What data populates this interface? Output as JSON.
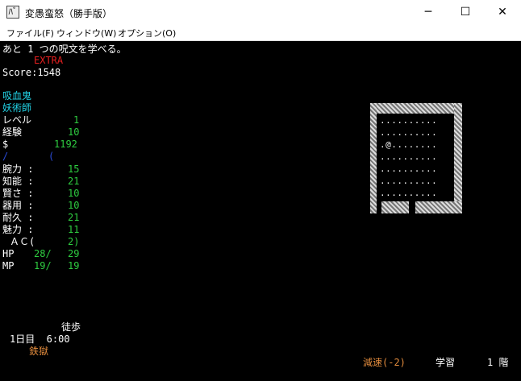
{
  "window": {
    "title": "変愚蛮怒（勝手版）",
    "icon_glyph": "ﾊﾞ",
    "minimize": "─",
    "maximize": "☐",
    "close": "✕"
  },
  "menu": [
    "ファイル(F)",
    "ウィンドウ(W)",
    "オプション(O)"
  ],
  "message": "あと 1 つの呪文を学べる。",
  "extra": "EXTRA",
  "score": "Score:1548",
  "race": "吸血鬼",
  "class": "妖術師",
  "level": {
    "label": "レベル",
    "value": "1"
  },
  "exp": {
    "label": "経験",
    "value": "10"
  },
  "gold": {
    "label": "$",
    "value": "1192"
  },
  "weapon_line": {
    "slash": "/",
    "paren": "("
  },
  "stats": [
    {
      "label": "腕力 :",
      "value": "15"
    },
    {
      "label": "知能 :",
      "value": "21"
    },
    {
      "label": "賢さ :",
      "value": "10"
    },
    {
      "label": "器用 :",
      "value": "10"
    },
    {
      "label": "耐久 :",
      "value": "21"
    },
    {
      "label": "魅力 :",
      "value": "11"
    }
  ],
  "ac": {
    "label": "ＡＣ(",
    "value": "2)"
  },
  "hp": {
    "label": "HP",
    "cur": "28/",
    "max": "29"
  },
  "mp": {
    "label": "MP",
    "cur": "19/",
    "max": "19"
  },
  "movement": "徒歩",
  "day": "1日目  6:00",
  "location": "鉄獄",
  "status_slow": "減速(-2)",
  "status_study": "学習",
  "depth": "1 階",
  "map_rows": [
    "..........",
    "..........",
    ".@........",
    "..........",
    "..........",
    "..........",
    ".........."
  ],
  "colors": {
    "white": "#ffffff",
    "green": "#2ecc40",
    "cyan": "#22d3e6",
    "red": "#e62020",
    "orange": "#e08a3c",
    "blue": "#2a4bd7"
  }
}
